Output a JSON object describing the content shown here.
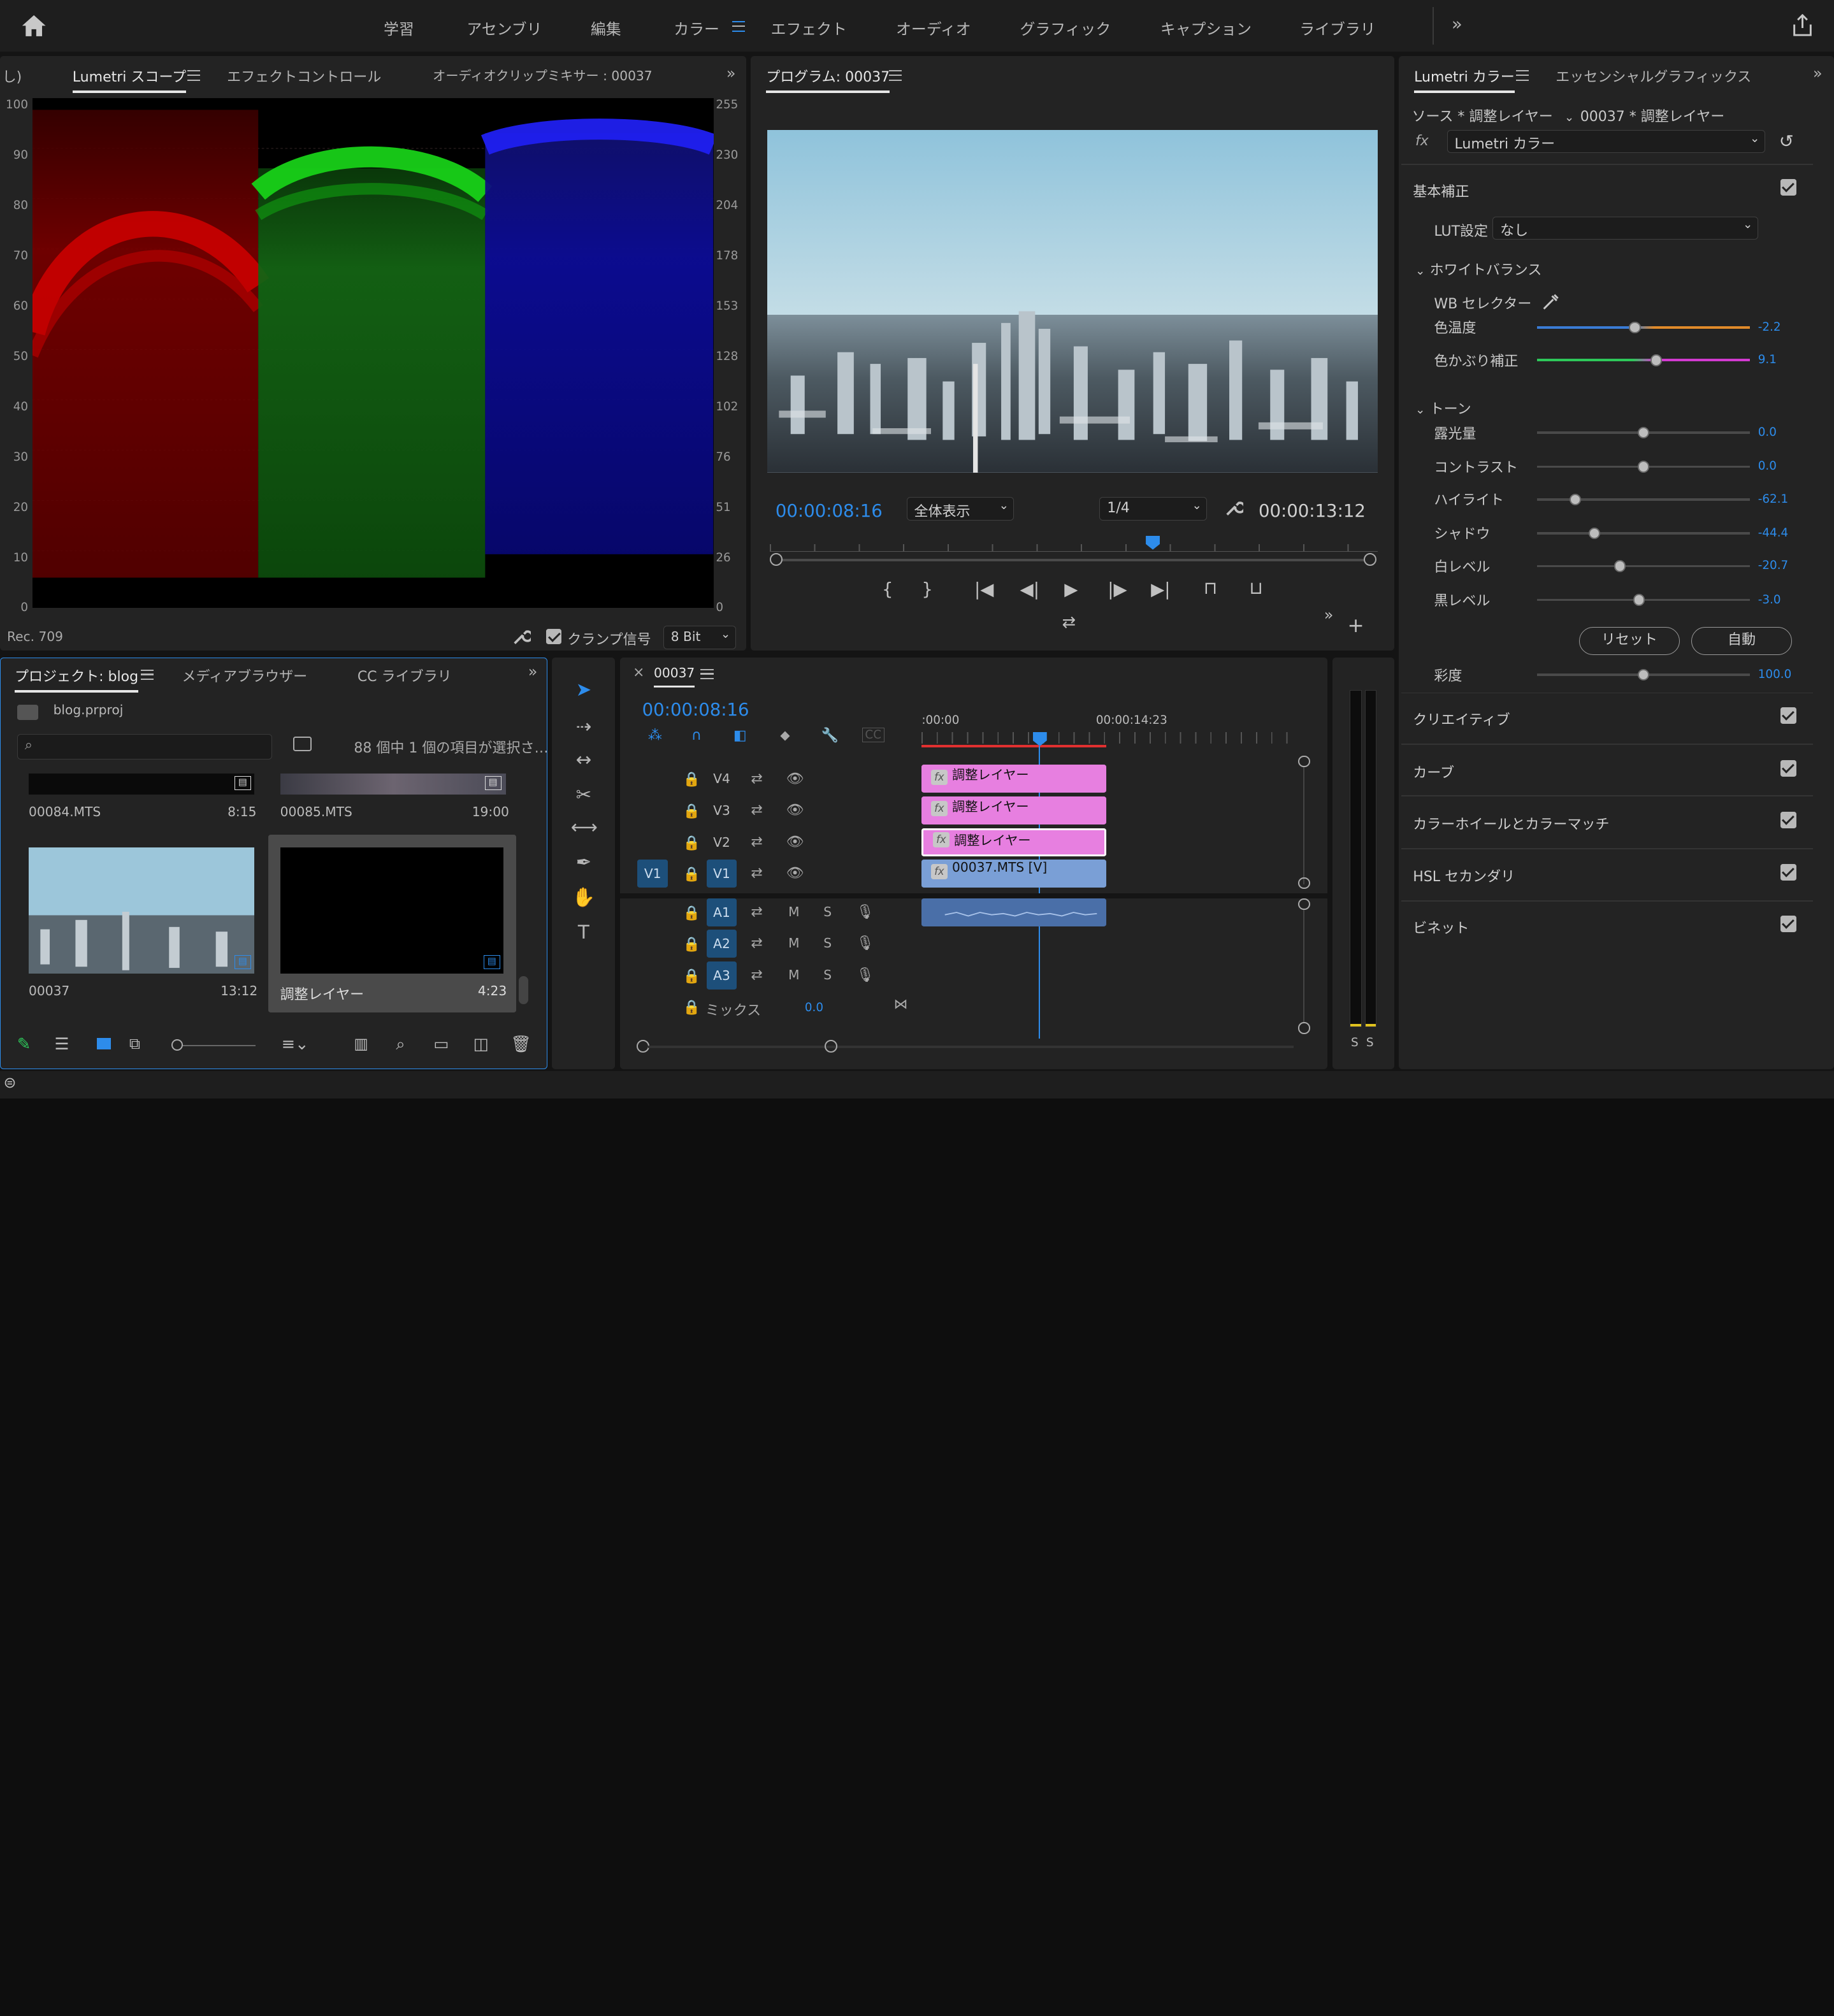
{
  "workspaces": [
    "学習",
    "アセンブリ",
    "編集",
    "カラー",
    "エフェクト",
    "オーディオ",
    "グラフィック",
    "キャプション",
    "ライブラリ"
  ],
  "active_workspace": "カラー",
  "scope_panel": {
    "tab_prev": "し)",
    "tab_active": "Lumetri スコープ",
    "tab2": "エフェクトコントロール",
    "tab3": "オーディオクリップミキサー : 00037",
    "left_axis": [
      "100",
      "90",
      "80",
      "70",
      "60",
      "50",
      "40",
      "30",
      "20",
      "10",
      "0"
    ],
    "right_axis": [
      "255",
      "230",
      "204",
      "178",
      "153",
      "128",
      "102",
      "76",
      "51",
      "26",
      "0"
    ],
    "footer_left": "Rec. 709",
    "clamp_label": "クランプ信号",
    "bit_depth": "8 Bit"
  },
  "program_monitor": {
    "title": "プログラム: 00037",
    "timecode_current": "00:00:08:16",
    "zoom": "全体表示",
    "resolution": "1/4",
    "timecode_duration": "00:00:13:12",
    "playhead_fraction": 0.63
  },
  "lumetri": {
    "tab_active": "Lumetri カラー",
    "tab2": "エッセンシャルグラフィックス",
    "source_label": "ソース * 調整レイヤー",
    "target_label": "00037 * 調整レイヤー",
    "fx_label": "fx",
    "effect_select": "Lumetri カラー",
    "basic": "基本補正",
    "lut_label": "LUT設定",
    "lut_value": "なし",
    "wb_section": "ホワイトバランス",
    "wb_selector": "WB セレクター",
    "tone_section": "トーン",
    "sliders": [
      {
        "label": "色温度",
        "value": "-2.2",
        "pos": 0.46
      },
      {
        "label": "色かぶり補正",
        "value": "9.1",
        "pos": 0.56
      },
      {
        "label": "露光量",
        "value": "0.0",
        "pos": 0.5
      },
      {
        "label": "コントラスト",
        "value": "0.0",
        "pos": 0.5
      },
      {
        "label": "ハイライト",
        "value": "-62.1",
        "pos": 0.18
      },
      {
        "label": "シャドウ",
        "value": "-44.4",
        "pos": 0.27
      },
      {
        "label": "白レベル",
        "value": "-20.7",
        "pos": 0.39
      },
      {
        "label": "黒レベル",
        "value": "-3.0",
        "pos": 0.48
      }
    ],
    "reset_button": "リセット",
    "auto_button": "自動",
    "saturation": {
      "label": "彩度",
      "value": "100.0",
      "pos": 0.5
    },
    "sections": [
      "クリエイティブ",
      "カーブ",
      "カラーホイールとカラーマッチ",
      "HSL セカンダリ",
      "ビネット"
    ]
  },
  "project": {
    "tab_active": "プロジェクト: blog",
    "tab2": "メディアブラウザー",
    "tab3": "CC ライブラリ",
    "file": "blog.prproj",
    "search_placeholder": "",
    "status": "88 個中 1 個の項目が選択さ…",
    "items": [
      {
        "name": "00084.MTS",
        "dur": "8:15"
      },
      {
        "name": "00085.MTS",
        "dur": "19:00"
      },
      {
        "name": "00037",
        "dur": "13:12"
      },
      {
        "name": "調整レイヤー",
        "dur": "4:23"
      }
    ]
  },
  "timeline": {
    "tab": "00037",
    "timecode": "00:00:08:16",
    "ruler": [
      ":00:00",
      "00:00:14:23"
    ],
    "video_tracks": [
      "V4",
      "V3",
      "V2",
      "V1"
    ],
    "audio_tracks": [
      "A1",
      "A2",
      "A3"
    ],
    "source_patch": "V1",
    "mix_label": "ミックス",
    "mix_value": "0.0",
    "m_label": "M",
    "s_label": "S",
    "clips": [
      "調整レイヤー",
      "調整レイヤー",
      "調整レイヤー",
      "00037.MTS [V]"
    ],
    "meter_labels": [
      "S",
      "S"
    ]
  },
  "colors": {
    "accent": "#2d8ceb",
    "adjust_clip": "#e77fe0",
    "video_clip": "#7a9fd6",
    "audio_clip": "#4a6fa8"
  }
}
